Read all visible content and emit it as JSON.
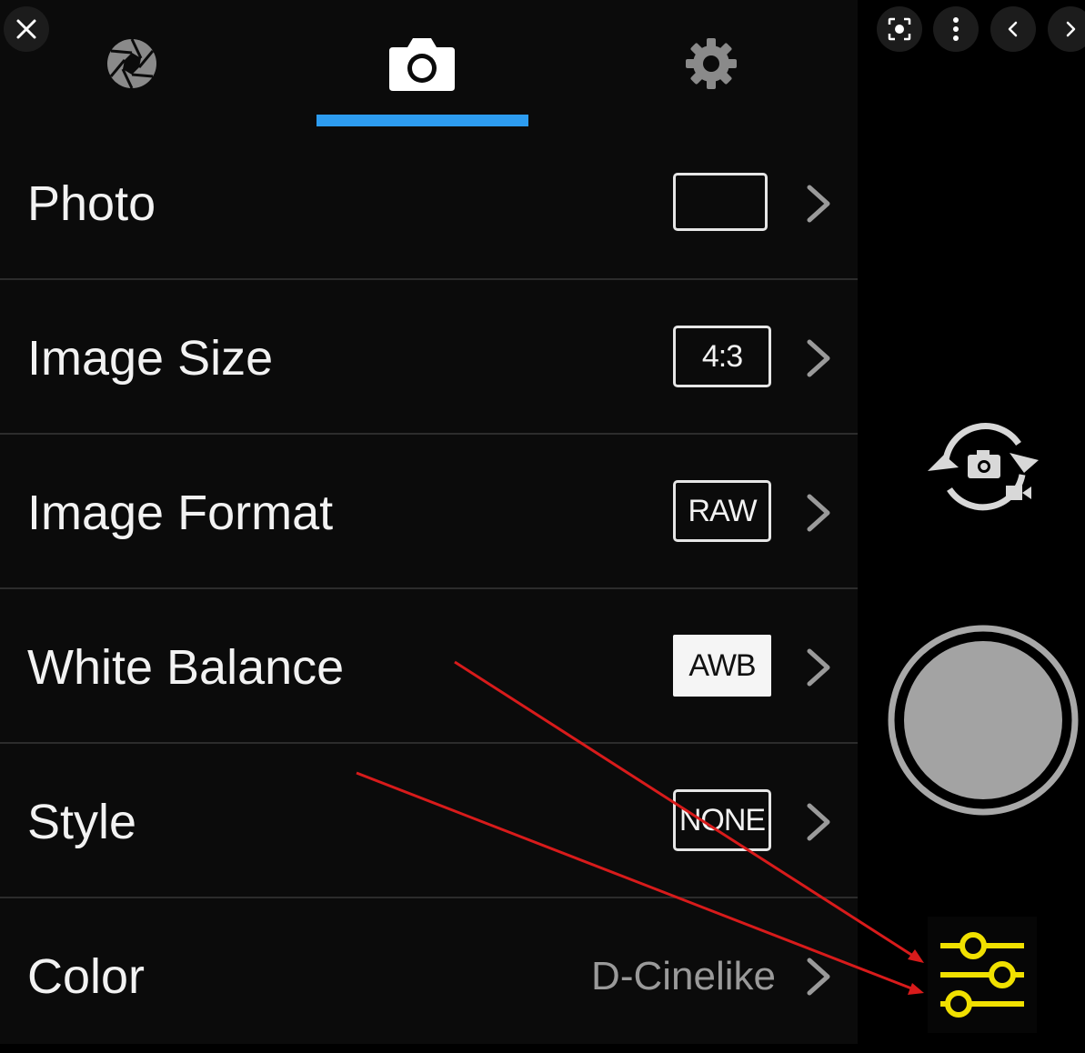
{
  "tabs": [
    {
      "icon": "aperture-icon"
    },
    {
      "icon": "camera-icon",
      "selected": true
    },
    {
      "icon": "gear-icon"
    }
  ],
  "accent_color": "#2d9cf0",
  "highlight_color": "#f0e000",
  "annotation_color": "#d81b1b",
  "settings": {
    "photo": {
      "label": "Photo",
      "badge": ""
    },
    "image_size": {
      "label": "Image Size",
      "badge": "4:3"
    },
    "image_format": {
      "label": "Image Format",
      "badge": "RAW"
    },
    "white_balance": {
      "label": "White Balance",
      "badge": "AWB"
    },
    "style": {
      "label": "Style",
      "badge": "NONE"
    },
    "color": {
      "label": "Color",
      "value": "D-Cinelike"
    }
  },
  "side_controls": {
    "switch_icon": "camera-video-switch-icon",
    "shutter_icon": "shutter-button",
    "adjust_icon": "sliders-icon"
  },
  "viewer_toolbar": {
    "close_icon": "close-icon",
    "lens_icon": "lens-search-icon",
    "more_icon": "more-vertical-icon",
    "prev_icon": "chevron-left-icon",
    "next_icon": "chevron-right-icon"
  }
}
